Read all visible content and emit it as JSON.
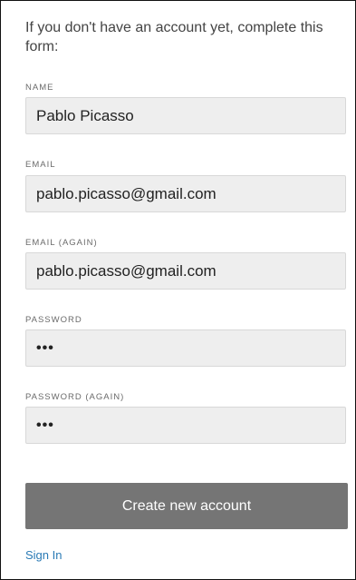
{
  "intro_text": "If you don't have an account yet, complete this form:",
  "fields": {
    "name": {
      "label": "NAME",
      "value": "Pablo Picasso"
    },
    "email": {
      "label": "EMAIL",
      "value": "pablo.picasso@gmail.com"
    },
    "email_again": {
      "label": "EMAIL (AGAIN)",
      "value": "pablo.picasso@gmail.com"
    },
    "password": {
      "label": "PASSWORD",
      "value": "•••"
    },
    "password_again": {
      "label": "PASSWORD (AGAIN)",
      "value": "•••"
    }
  },
  "create_button": "Create new account",
  "signin_link": "Sign In",
  "colors": {
    "button_bg": "#757575",
    "input_bg": "#eeeeee",
    "link": "#2a7ab5"
  }
}
